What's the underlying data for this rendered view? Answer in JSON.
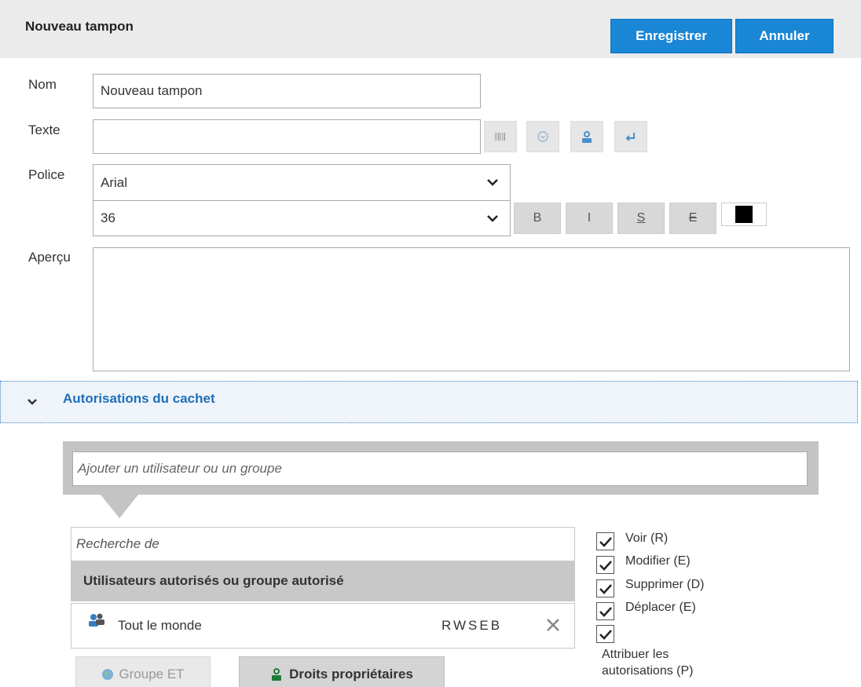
{
  "header": {
    "title": "Nouveau tampon",
    "save_label": "Enregistrer",
    "cancel_label": "Annuler"
  },
  "form": {
    "name_label": "Nom",
    "name_value": "Nouveau tampon",
    "text_label": "Texte",
    "text_value": "",
    "font_label": "Police",
    "font_value": "Arial",
    "size_value": "36",
    "preview_label": "Aperçu",
    "format_buttons": {
      "bold": "B",
      "italic": "I",
      "underline": "S",
      "strike": "E"
    },
    "text_color": "#000000"
  },
  "permissions": {
    "section_title": "Autorisations du cachet",
    "add_placeholder": "Ajouter un utilisateur ou un groupe",
    "search_placeholder": "Recherche de",
    "list_header": "Utilisateurs autorisés ou groupe autorisé",
    "entries": [
      {
        "name": "Tout le monde",
        "rights": "RWSEB"
      }
    ],
    "group_button": "Groupe ET",
    "owner_button": "Droits propriétaires",
    "checkboxes": [
      {
        "label": "Voir (R)",
        "checked": true
      },
      {
        "label": "Modifier (E)",
        "checked": true
      },
      {
        "label": "Supprimer (D)",
        "checked": true
      },
      {
        "label": "Déplacer (E)",
        "checked": true
      },
      {
        "label": "Attribuer les autorisations (P)",
        "checked": true
      }
    ]
  },
  "colors": {
    "accent": "#1a86d6",
    "link": "#1f6fb8"
  }
}
